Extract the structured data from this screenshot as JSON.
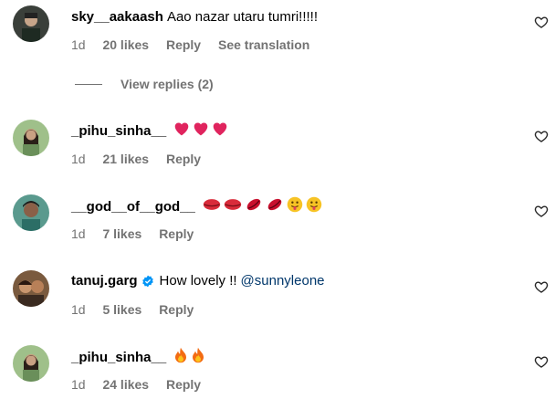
{
  "comments": [
    {
      "username": "sky__aakaash",
      "text": "Aao nazar utaru tumri!!!!!",
      "time": "1d",
      "likes": "20 likes",
      "reply": "Reply",
      "translate": "See translation"
    },
    {
      "username": "_pihu_sinha__",
      "text": "",
      "emoji": [
        "red-heart",
        "red-heart",
        "red-heart"
      ],
      "time": "1d",
      "likes": "21 likes",
      "reply": "Reply"
    },
    {
      "username": "__god__of__god__",
      "text": "",
      "emoji": [
        "lips",
        "lips",
        "kiss-mark",
        "kiss-mark",
        "tongue-face",
        "tongue-face"
      ],
      "time": "1d",
      "likes": "7 likes",
      "reply": "Reply"
    },
    {
      "username": "tanuj.garg",
      "verified": true,
      "text": "How lovely !!",
      "mention": "@sunnyleone",
      "time": "1d",
      "likes": "5 likes",
      "reply": "Reply"
    },
    {
      "username": "_pihu_sinha__",
      "text": "",
      "emoji": [
        "fire",
        "fire"
      ],
      "time": "1d",
      "likes": "24 likes",
      "reply": "Reply"
    }
  ],
  "view_replies": "View replies (2)",
  "icons": {
    "like": "heart-outline-icon",
    "verified": "verified-badge-icon"
  },
  "colors": {
    "meta": "#737373",
    "mention": "#00376b",
    "verified": "#0095f6",
    "heart_emoji": "#e0245e"
  }
}
